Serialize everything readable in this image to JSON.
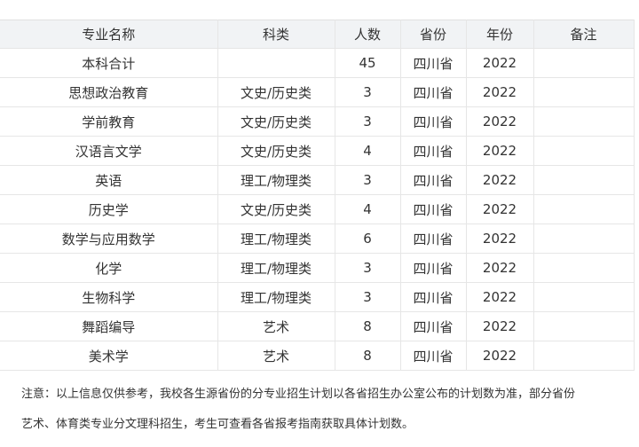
{
  "table": {
    "headers": [
      "专业名称",
      "科类",
      "人数",
      "省份",
      "年份",
      "备注"
    ],
    "rows": [
      [
        "本科合计",
        "",
        "45",
        "四川省",
        "2022",
        ""
      ],
      [
        "思想政治教育",
        "文史/历史类",
        "3",
        "四川省",
        "2022",
        ""
      ],
      [
        "学前教育",
        "文史/历史类",
        "3",
        "四川省",
        "2022",
        ""
      ],
      [
        "汉语言文学",
        "文史/历史类",
        "4",
        "四川省",
        "2022",
        ""
      ],
      [
        "英语",
        "理工/物理类",
        "3",
        "四川省",
        "2022",
        ""
      ],
      [
        "历史学",
        "文史/历史类",
        "4",
        "四川省",
        "2022",
        ""
      ],
      [
        "数学与应用数学",
        "理工/物理类",
        "6",
        "四川省",
        "2022",
        ""
      ],
      [
        "化学",
        "理工/物理类",
        "3",
        "四川省",
        "2022",
        ""
      ],
      [
        "生物科学",
        "理工/物理类",
        "3",
        "四川省",
        "2022",
        ""
      ],
      [
        "舞蹈编导",
        "艺术",
        "8",
        "四川省",
        "2022",
        ""
      ],
      [
        "美术学",
        "艺术",
        "8",
        "四川省",
        "2022",
        ""
      ]
    ]
  },
  "note": {
    "line1": "注意：以上信息仅供参考，我校各生源省份的分专业招生计划以各省招生办公室公布的计划数为准，部分省份",
    "line2": "艺术、体育类专业分文理科招生，考生可查看各省报考指南获取具体计划数。"
  }
}
